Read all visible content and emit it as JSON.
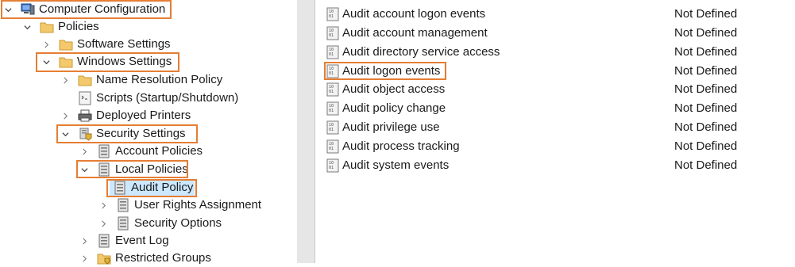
{
  "tree": {
    "computer_configuration": "Computer Configuration",
    "policies": "Policies",
    "software_settings": "Software Settings",
    "windows_settings": "Windows Settings",
    "name_resolution_policy": "Name Resolution Policy",
    "scripts": "Scripts (Startup/Shutdown)",
    "deployed_printers": "Deployed Printers",
    "security_settings": "Security Settings",
    "account_policies": "Account Policies",
    "local_policies": "Local Policies",
    "audit_policy": "Audit Policy",
    "user_rights_assignment": "User Rights Assignment",
    "security_options": "Security Options",
    "event_log": "Event Log",
    "restricted_groups": "Restricted Groups"
  },
  "policy_list": [
    {
      "name": "Audit account logon events",
      "setting": "Not Defined"
    },
    {
      "name": "Audit account management",
      "setting": "Not Defined"
    },
    {
      "name": "Audit directory service access",
      "setting": "Not Defined"
    },
    {
      "name": "Audit logon events",
      "setting": "Not Defined"
    },
    {
      "name": "Audit object access",
      "setting": "Not Defined"
    },
    {
      "name": "Audit policy change",
      "setting": "Not Defined"
    },
    {
      "name": "Audit privilege use",
      "setting": "Not Defined"
    },
    {
      "name": "Audit process tracking",
      "setting": "Not Defined"
    },
    {
      "name": "Audit system events",
      "setting": "Not Defined"
    }
  ],
  "icons": {
    "computer": "computer-icon",
    "folder": "folder-icon",
    "script": "script-icon",
    "printer": "printer-icon",
    "security": "security-settings-icon",
    "policy": "policy-icon",
    "audit_item": "audit-item-icon"
  },
  "colors": {
    "highlight_border": "#e57e34",
    "selected_background": "#cce8ff",
    "folder": "#f3c96b"
  }
}
